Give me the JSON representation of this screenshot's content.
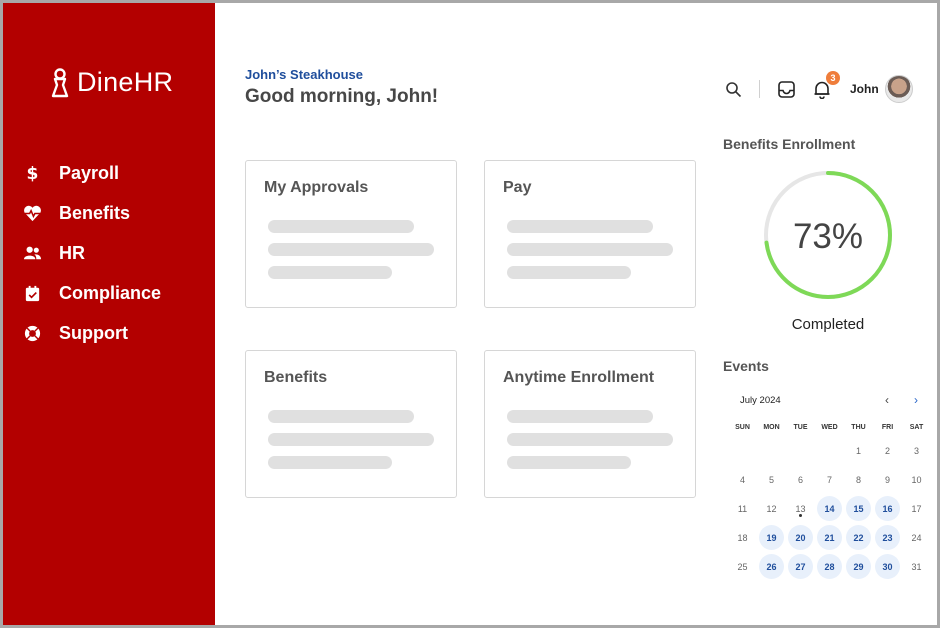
{
  "app": {
    "name": "DineHR"
  },
  "sidebar": {
    "items": [
      {
        "label": "Payroll",
        "icon": "dollar-icon"
      },
      {
        "label": "Benefits",
        "icon": "heart-pulse-icon"
      },
      {
        "label": "HR",
        "icon": "people-icon"
      },
      {
        "label": "Compliance",
        "icon": "calendar-check-icon"
      },
      {
        "label": "Support",
        "icon": "lifebuoy-icon"
      }
    ]
  },
  "header": {
    "org_name": "John’s Steakhouse",
    "greeting": "Good morning, John!",
    "notification_count": "3",
    "user_name": "John"
  },
  "cards": [
    {
      "title": "My Approvals"
    },
    {
      "title": "Pay"
    },
    {
      "title": "Benefits"
    },
    {
      "title": "Anytime Enrollment"
    }
  ],
  "enrollment": {
    "title": "Benefits Enrollment",
    "percent_label": "73%",
    "percent_value": 0.73,
    "status": "Completed",
    "colors": {
      "progress": "#7ed957",
      "track": "#e6e6e6"
    }
  },
  "events": {
    "title": "Events",
    "month": "July 2024",
    "weekdays": [
      "SUN",
      "MON",
      "TUE",
      "WED",
      "THU",
      "FRI",
      "SAT"
    ],
    "days": [
      "",
      "",
      "",
      "",
      "1",
      "2",
      "3",
      "4",
      "5",
      "6",
      "7",
      "8",
      "9",
      "10",
      "11",
      "12",
      "13",
      "14",
      "15",
      "16",
      "17",
      "18",
      "19",
      "20",
      "21",
      "22",
      "23",
      "24",
      "25",
      "26",
      "27",
      "28",
      "29",
      "30",
      "31"
    ],
    "highlighted_days": [
      "14",
      "15",
      "16",
      "19",
      "20",
      "21",
      "22",
      "23",
      "26",
      "27",
      "28",
      "29",
      "30"
    ],
    "marked_day": "13"
  },
  "colors": {
    "brand": "#b30000",
    "accent_blue": "#1f4e9c",
    "badge": "#ef7d3b"
  }
}
